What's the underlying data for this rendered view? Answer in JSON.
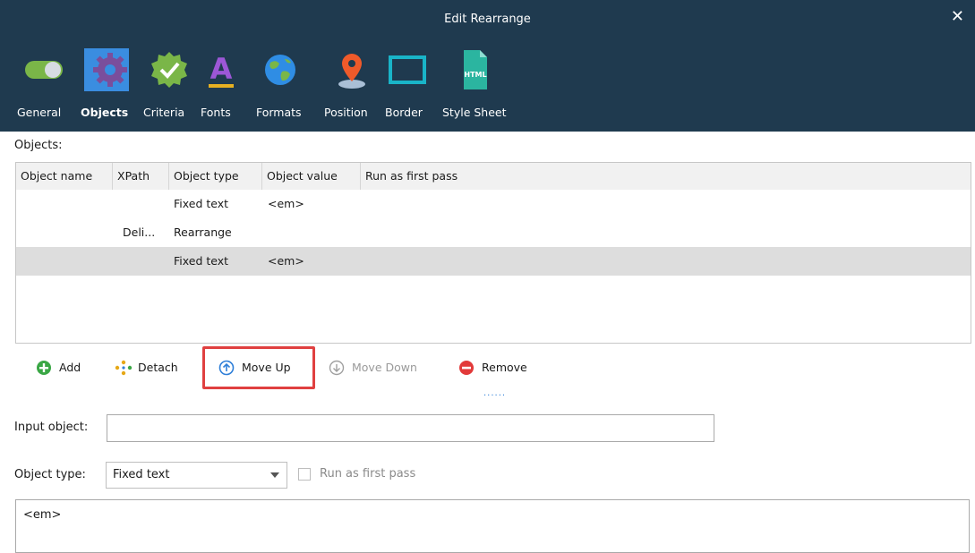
{
  "window": {
    "title": "Edit Rearrange",
    "close_symbol": "✕"
  },
  "tabs": [
    {
      "label": "General",
      "icon": "toggle-switch-icon"
    },
    {
      "label": "Objects",
      "icon": "gear-icon",
      "active": true
    },
    {
      "label": "Criteria",
      "icon": "badge-check-icon"
    },
    {
      "label": "Fonts",
      "icon": "font-letter-a-icon"
    },
    {
      "label": "Formats",
      "icon": "globe-icon"
    },
    {
      "label": "Position",
      "icon": "location-pin-icon"
    },
    {
      "label": "Border",
      "icon": "border-frame-icon"
    },
    {
      "label": "Style Sheet",
      "icon": "html-file-icon",
      "badge": "HTML"
    }
  ],
  "objects_label": "Objects:",
  "table": {
    "columns": [
      "Object name",
      "XPath",
      "Object type",
      "Object value",
      "Run as first pass"
    ],
    "rows": [
      {
        "name": "",
        "xpath": "",
        "type": "Fixed text",
        "value": "<em>",
        "first": ""
      },
      {
        "name": "",
        "xpath": "Deli...",
        "type": "Rearrange",
        "value": "",
        "first": ""
      },
      {
        "name": "",
        "xpath": "",
        "type": "Fixed text",
        "value": "<em>",
        "first": "",
        "selected": true
      }
    ]
  },
  "toolbar": {
    "add": "Add",
    "detach": "Detach",
    "move_up": "Move Up",
    "move_down": "Move Down",
    "remove": "Remove",
    "dots": "......"
  },
  "colors": {
    "header_bg": "#1f3a4f",
    "accent": "#3a8de0",
    "highlight": "#e04040",
    "add_green": "#3aa745",
    "remove_red": "#e23a3a"
  },
  "form": {
    "input_object_label": "Input object:",
    "input_object_value": "",
    "object_type_label": "Object type:",
    "object_type_value": "Fixed text",
    "run_first_label": "Run as first pass",
    "value_text": "<em>"
  }
}
